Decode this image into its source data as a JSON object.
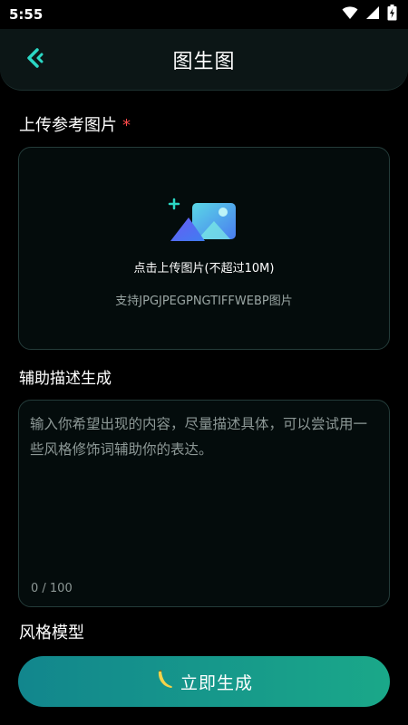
{
  "status_bar": {
    "time": "5:55",
    "icons": [
      "wifi-icon",
      "signal-icon",
      "battery-charging-icon"
    ]
  },
  "header": {
    "title": "图生图",
    "back_icon": "back-chevron-icon",
    "accent_color": "#2bd7c4"
  },
  "upload": {
    "label": "上传参考图片",
    "required_mark": "*",
    "icon": "add-image-icon",
    "main_text": "点击上传图片(不超过10M)",
    "sub_text": "支持JPGJPEGPNGTIFFWEBP图片"
  },
  "description": {
    "label": "辅助描述生成",
    "placeholder": "输入你希望出现的内容，尽量描述具体，可以尝试用一些风格修饰词辅助你的表达。",
    "counter": "0 / 100"
  },
  "style_model": {
    "label": "风格模型"
  },
  "generate_button": {
    "label": "立即生成",
    "icon": "banana-icon"
  },
  "colors": {
    "background": "#000000",
    "card_border": "#243c3a",
    "button_gradient_start": "#12868d",
    "button_gradient_end": "#1aa889",
    "required": "#ff4a4a"
  }
}
